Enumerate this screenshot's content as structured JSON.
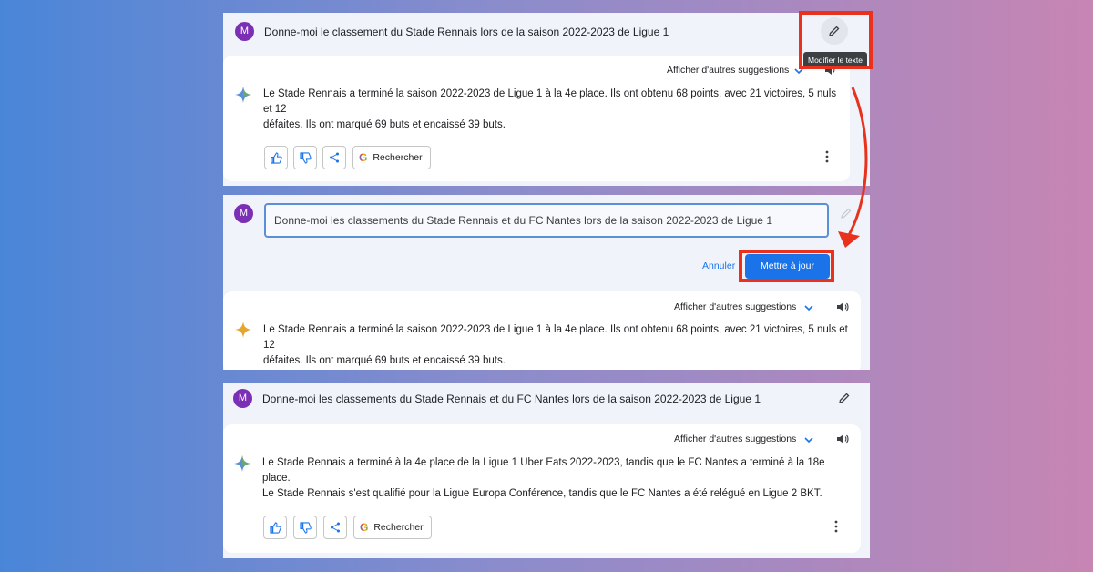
{
  "panel1": {
    "avatar": "M",
    "prompt": "Donne-moi le classement du Stade Rennais lors de la saison 2022-2023 de Ligue 1",
    "suggestions_label": "Afficher d'autres suggestions",
    "tooltip": "Modifier le texte",
    "answer_line1": "Le Stade Rennais a terminé la saison 2022-2023 de Ligue 1 à la 4e place. Ils ont obtenu 68 points, avec 21 victoires, 5 nuls et 12",
    "answer_line2": "défaites. Ils ont marqué 69 buts et encaissé 39 buts.",
    "search_label": "Rechercher"
  },
  "panel2": {
    "avatar": "M",
    "edit_value": "Donne-moi les classements du Stade Rennais et du FC Nantes lors de la saison 2022-2023 de Ligue 1",
    "cancel_label": "Annuler",
    "update_label": "Mettre à jour",
    "suggestions_label": "Afficher d'autres suggestions",
    "answer_line1": "Le Stade Rennais a terminé la saison 2022-2023 de Ligue 1 à la 4e place. Ils ont obtenu 68 points, avec 21 victoires, 5 nuls et 12",
    "answer_line2": "défaites. Ils ont marqué 69 buts et encaissé 39 buts."
  },
  "panel3": {
    "avatar": "M",
    "prompt": "Donne-moi les classements du Stade Rennais et du FC Nantes lors de la saison 2022-2023 de Ligue 1",
    "suggestions_label": "Afficher d'autres suggestions",
    "answer_line1": "Le Stade Rennais a terminé à la 4e place de la Ligue 1 Uber Eats 2022-2023, tandis que le FC Nantes a terminé à la 18e place.",
    "answer_line2": "Le Stade Rennais s'est qualifié pour la Ligue Europa Conférence, tandis que le FC Nantes a été relégué en Ligue 2 BKT.",
    "search_label": "Rechercher"
  },
  "colors": {
    "accent": "#1a73e8",
    "highlight": "#e8321e",
    "avatar": "#7b2fb5",
    "panel_bg": "#f0f4fa"
  },
  "icons": [
    "avatar",
    "pencil-icon",
    "chevron-down-icon",
    "speaker-icon",
    "sparkle-icon",
    "thumbs-up-icon",
    "thumbs-down-icon",
    "share-icon",
    "google-icon",
    "more-vert-icon",
    "red-arrow"
  ]
}
